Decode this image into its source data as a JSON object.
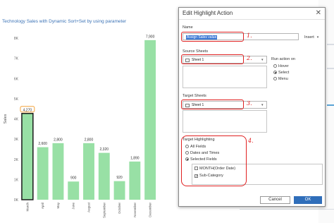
{
  "chart": {
    "title": "Technology Sales with Dynamic Sort+Set by using parameter"
  },
  "chart_data": {
    "type": "bar",
    "title": "Technology Sales with Dynamic Sort+Set by using parameter",
    "ylabel": "Sales",
    "xlabel": "",
    "categories": [
      "March",
      "April",
      "May",
      "June",
      "August",
      "September",
      "October",
      "November",
      "December"
    ],
    "values": [
      4270,
      2600,
      2800,
      900,
      2800,
      2320,
      920,
      1890,
      7900
    ],
    "value_labels": [
      "4,270",
      "2,600",
      "2,800",
      "900",
      "2,800",
      "2,320",
      "920",
      "1,890",
      "7,900"
    ],
    "yticks": [
      "0K",
      "1K",
      "2K",
      "3K",
      "4K",
      "5K",
      "6K",
      "7K",
      "8K"
    ],
    "ylim": [
      0,
      8000
    ],
    "highlighted_category": "March",
    "colors": {
      "bar": "#98e0a5",
      "bar_highlight": "#98e0a5",
      "highlight_border": "#1a1a1a",
      "label_box": "#f3a23a"
    },
    "grid": false
  },
  "dialog": {
    "title": "Edit Highlight Action",
    "close_glyph": "✕",
    "name_label": "Name",
    "name_value": "Assign Sales value",
    "insert_label": "Insert",
    "source_label": "Source Sheets",
    "source_value": "Sheet 1",
    "run_action_label": "Run action on",
    "run_options": [
      {
        "label": "Hover",
        "selected": false
      },
      {
        "label": "Select",
        "selected": true
      },
      {
        "label": "Menu",
        "selected": false
      }
    ],
    "target_sheets_label": "Target Sheets",
    "target_sheets_value": "Sheet 1",
    "target_highlight_label": "Target Highlighting",
    "highlight_options": [
      {
        "label": "All Fields",
        "selected": false
      },
      {
        "label": "Dates and Times",
        "selected": false
      },
      {
        "label": "Selected Fields",
        "selected": true
      }
    ],
    "fields": [
      {
        "label": "MONTH(Order Date)",
        "checked": false
      },
      {
        "label": "Sub-Category",
        "checked": true
      }
    ],
    "cancel_label": "Cancel",
    "ok_label": "OK"
  },
  "annotations": {
    "n1": "1.",
    "n2": "2.",
    "n3": "3.",
    "n4": "4."
  }
}
